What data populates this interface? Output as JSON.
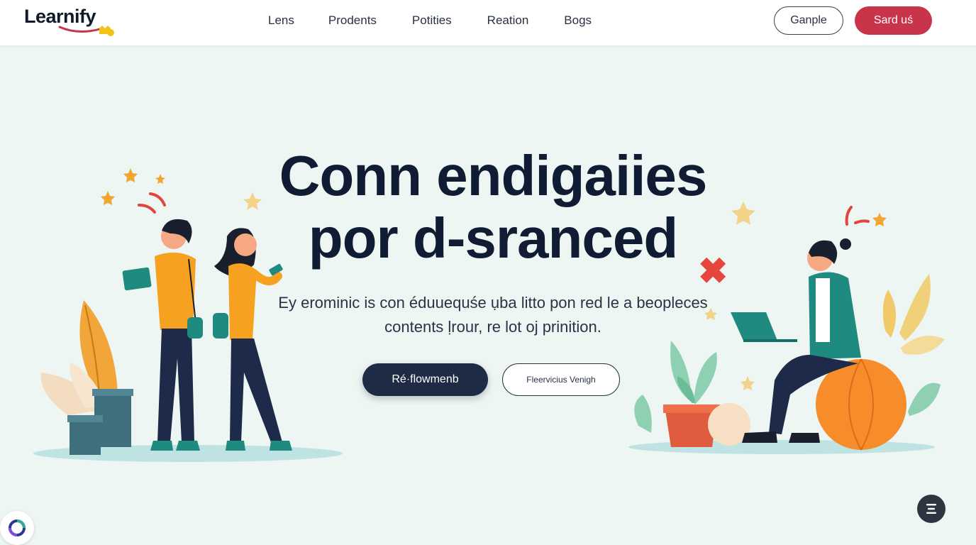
{
  "brand": {
    "name": "Learnify"
  },
  "nav": {
    "links": [
      "Lens",
      "Prodents",
      "Potities",
      "Reation",
      "Bogs"
    ],
    "login_label": "Ganple",
    "signup_label": "Sard uś"
  },
  "hero": {
    "title_line1": "Conn endigaiies",
    "title_line2": "por d-sranced",
    "description": "Ey erominic is con éduuequśe ụba litto pon red le a beopleces contents ḷrour, re lot oj prinition.",
    "primary_cta": "Ré·flowmenb",
    "secondary_cta": "Fleervicius Venigh"
  },
  "colors": {
    "accent": "#c8344a",
    "dark": "#1d2b45",
    "teal": "#1f8a80",
    "orange": "#f6a51d",
    "background": "#edf6f3"
  },
  "icons": {
    "chat": "menu-lines-icon",
    "corner": "circle-logo-icon"
  }
}
